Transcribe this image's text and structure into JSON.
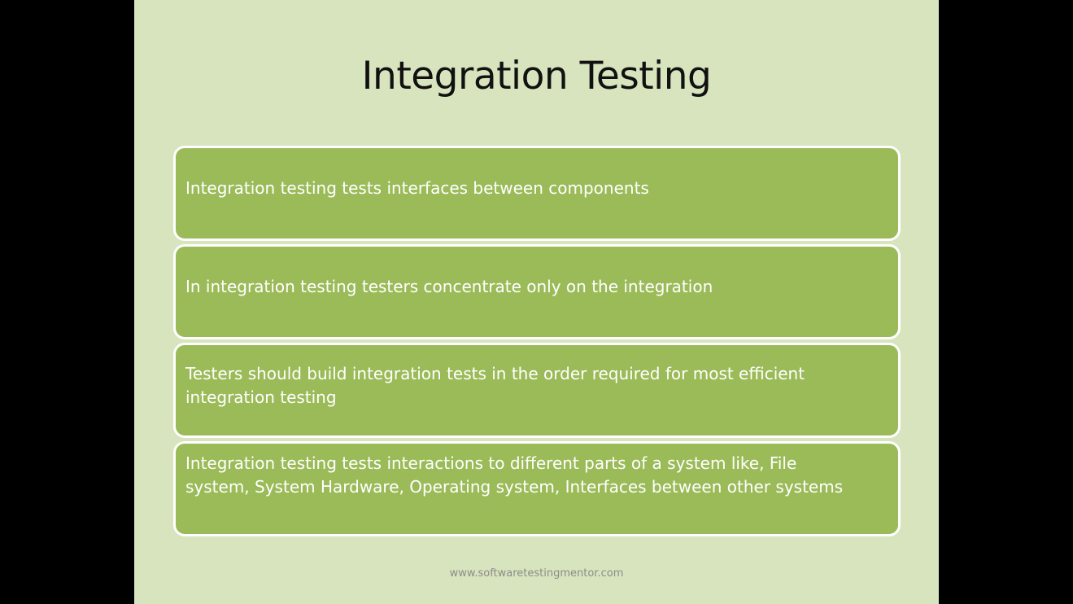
{
  "slide": {
    "title": "Integration Testing",
    "items": [
      "Integration testing tests interfaces between components",
      "In integration testing testers concentrate only on the integration",
      "Testers should build integration tests in the order required  for most efficient integration testing",
      "Integration testing tests interactions to different parts of a system like, File system, System Hardware, Operating system, Interfaces between other systems"
    ],
    "footer": "www.softwaretestingmentor.com"
  },
  "colors": {
    "slide_background": "#d7e4bd",
    "box_fill": "#9bbb59",
    "box_border": "#ffffff",
    "letterbox": "#000000"
  }
}
